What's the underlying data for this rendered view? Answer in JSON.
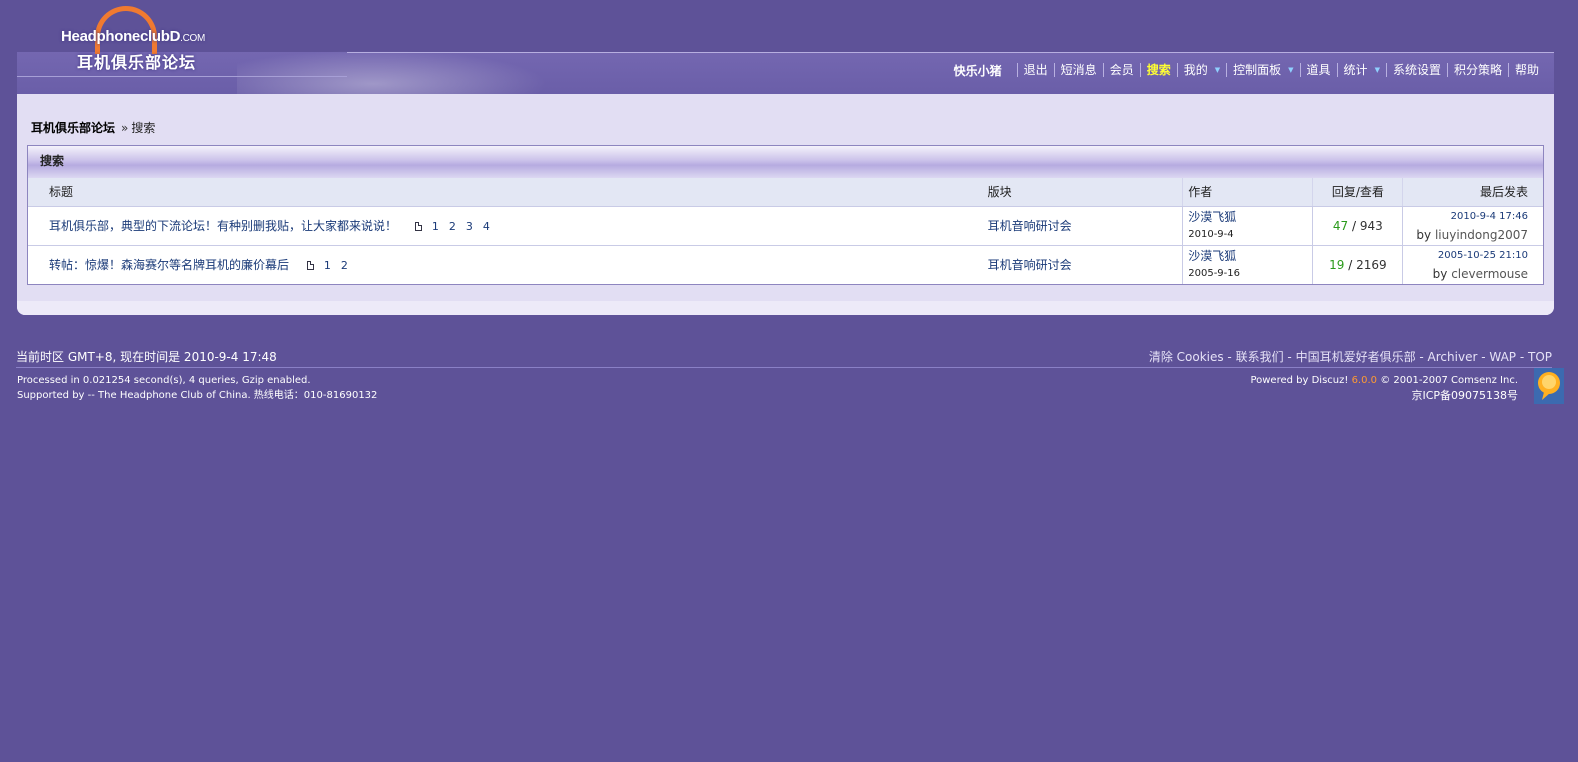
{
  "header": {
    "logo_en": "HeadphoneclubD",
    "logo_domain": ".COM",
    "logo_cn": "耳机俱乐部论坛",
    "username": "快乐小猪",
    "nav": [
      {
        "label": "退出"
      },
      {
        "label": "短消息"
      },
      {
        "label": "会员"
      },
      {
        "label": "搜索"
      },
      {
        "label": "我的"
      },
      {
        "label": "控制面板"
      },
      {
        "label": "道具"
      },
      {
        "label": "统计"
      },
      {
        "label": "系统设置"
      },
      {
        "label": "积分策略"
      },
      {
        "label": "帮助"
      }
    ]
  },
  "breadcrumb": {
    "home": "耳机俱乐部论坛",
    "sep": "»",
    "current": "搜索"
  },
  "search_box": {
    "title": "搜索",
    "columns": {
      "subject": "标题",
      "forum": "版块",
      "author": "作者",
      "replies_views": "回复/查看",
      "last_post": "最后发表"
    },
    "rows": [
      {
        "subject": "耳机俱乐部，典型的下流论坛！有种别删我贴，让大家都来说说！",
        "pages": [
          "1",
          "2",
          "3",
          "4"
        ],
        "forum": "耳机音响研讨会",
        "author": "沙漠飞狐",
        "author_date": "2010-9-4",
        "replies": "47",
        "slash": "/",
        "views": "943",
        "last_date": "2010-9-4 17:46",
        "last_by_prefix": "by",
        "last_by": "liuyindong2007"
      },
      {
        "subject": "转帖：惊爆！森海赛尔等名牌耳机的廉价幕后",
        "pages": [
          "1",
          "2"
        ],
        "forum": "耳机音响研讨会",
        "author": "沙漠飞狐",
        "author_date": "2005-9-16",
        "replies": "19",
        "slash": "/",
        "views": "2169",
        "last_date": "2005-10-25 21:10",
        "last_by_prefix": "by",
        "last_by": "clevermouse"
      }
    ]
  },
  "footer": {
    "timezone": "当前时区  GMT+8, 现在时间是  2010-9-4 17:48",
    "links": [
      {
        "label": "清除  Cookies"
      },
      {
        "label": "联系我们"
      },
      {
        "label": "中国耳机爱好者俱乐部"
      },
      {
        "label": "Archiver"
      },
      {
        "label": "WAP"
      },
      {
        "label": "TOP"
      }
    ],
    "processed": "Processed in 0.021254 second(s), 4 queries, Gzip enabled.",
    "supported": "Supported by -- The Headphone Club of China. 热线电话：010-81690132",
    "powered_prefix": "Powered by Discuz! ",
    "powered_version": "6.0.0",
    "powered_suffix": " © 2001-2007 Comsenz Inc.",
    "icp": "京ICP备09075138号"
  }
}
